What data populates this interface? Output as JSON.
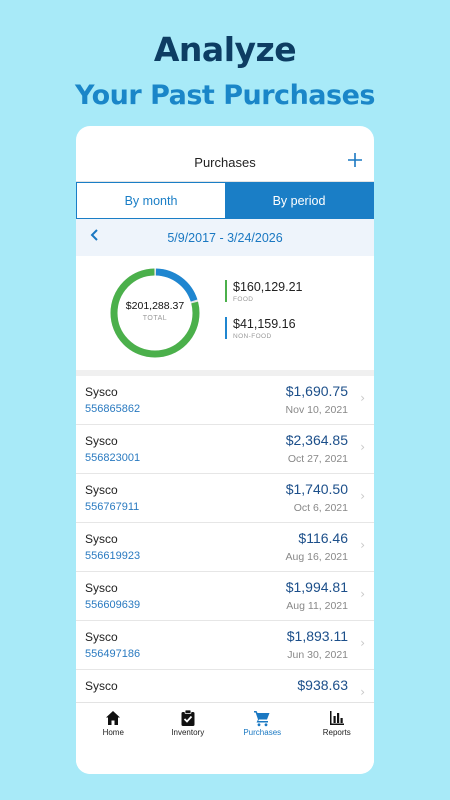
{
  "promo": {
    "headline": "Analyze",
    "subheadline": "Your Past Purchases"
  },
  "header": {
    "title": "Purchases",
    "add_icon": "plus-icon"
  },
  "segment": {
    "by_month": "By month",
    "by_period": "By period",
    "selected": "By period"
  },
  "period": {
    "back_icon": "chevron-left-icon",
    "range": "5/9/2017 - 3/24/2026"
  },
  "summary": {
    "total": "$201,288.37",
    "total_label": "TOTAL",
    "food": {
      "amount": "$160,129.21",
      "label": "FOOD",
      "fraction": 0.7955,
      "color": "#4bb04b"
    },
    "nonfood": {
      "amount": "$41,159.16",
      "label": "NON-FOOD",
      "fraction": 0.2045,
      "color": "#1f86d0"
    }
  },
  "orders": [
    {
      "vendor": "Sysco",
      "invoice": "556865862",
      "amount": "$1,690.75",
      "date": "Nov 10, 2021"
    },
    {
      "vendor": "Sysco",
      "invoice": "556823001",
      "amount": "$2,364.85",
      "date": "Oct 27, 2021"
    },
    {
      "vendor": "Sysco",
      "invoice": "556767911",
      "amount": "$1,740.50",
      "date": "Oct 6, 2021"
    },
    {
      "vendor": "Sysco",
      "invoice": "556619923",
      "amount": "$116.46",
      "date": "Aug 16, 2021"
    },
    {
      "vendor": "Sysco",
      "invoice": "556609639",
      "amount": "$1,994.81",
      "date": "Aug 11, 2021"
    },
    {
      "vendor": "Sysco",
      "invoice": "556497186",
      "amount": "$1,893.11",
      "date": "Jun 30, 2021"
    },
    {
      "vendor": "Sysco",
      "invoice": "",
      "amount": "$938.63",
      "date": ""
    }
  ],
  "tabs": [
    {
      "label": "Home",
      "icon": "home-icon"
    },
    {
      "label": "Inventory",
      "icon": "clipboard-check-icon"
    },
    {
      "label": "Purchases",
      "icon": "cart-icon"
    },
    {
      "label": "Reports",
      "icon": "bar-chart-icon"
    }
  ],
  "colors": {
    "background": "#a8eaf8",
    "headline": "#0d3d63",
    "accent": "#1a7ec6",
    "food": "#4bb04b",
    "nonfood": "#1f86d0"
  }
}
